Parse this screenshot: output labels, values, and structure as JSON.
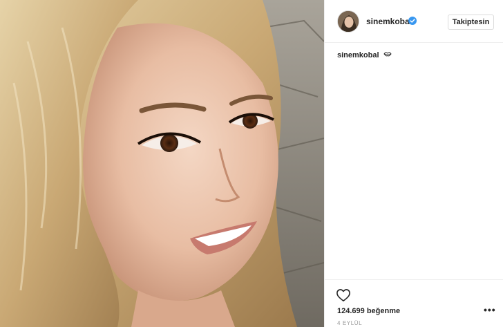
{
  "post": {
    "username": "sinemkobal",
    "verified": true,
    "follow_label": "Takiptesin",
    "caption_user": "sinemkobal",
    "caption_emoji": "kiss-lips-icon",
    "likes_text": "124.699 beğenme",
    "date_text": "4 EYLÜL"
  },
  "icons": {
    "verified": "verified-badge-icon",
    "heart": "heart-outline-icon",
    "more": "more-options-icon"
  },
  "colors": {
    "verified_blue": "#3897f0",
    "text": "#262626",
    "muted": "#999999",
    "border": "#efefef"
  }
}
